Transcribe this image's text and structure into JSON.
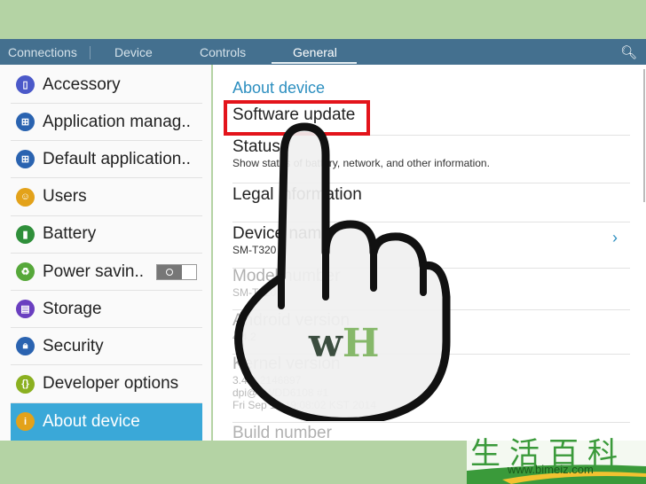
{
  "tabs": [
    {
      "label": "Connections"
    },
    {
      "label": "Device"
    },
    {
      "label": "Controls"
    },
    {
      "label": "General",
      "active": true
    }
  ],
  "search_icon": "search-icon",
  "sidebar": {
    "items": [
      {
        "label": "Accessory",
        "icon": "accessory-icon",
        "color": "#4b59c9"
      },
      {
        "label": "Application manag..",
        "icon": "apps-grid-icon",
        "color": "#2a63b0"
      },
      {
        "label": "Default application..",
        "icon": "default-apps-icon",
        "color": "#2a63b0"
      },
      {
        "label": "Users",
        "icon": "users-icon",
        "color": "#e3a21a"
      },
      {
        "label": "Battery",
        "icon": "battery-icon",
        "color": "#2f8f3a"
      },
      {
        "label": "Power savin..",
        "icon": "power-saving-icon",
        "color": "#56a83a",
        "toggle": "off"
      },
      {
        "label": "Storage",
        "icon": "storage-icon",
        "color": "#6a3fc0"
      },
      {
        "label": "Security",
        "icon": "lock-icon",
        "color": "#2a63b0"
      },
      {
        "label": "Developer options",
        "icon": "developer-icon",
        "color": "#8bb020"
      },
      {
        "label": "About device",
        "icon": "info-icon",
        "color": "#e3a21a",
        "selected": true
      }
    ]
  },
  "main": {
    "header": "About device",
    "rows": [
      {
        "title": "Software update",
        "sub": ""
      },
      {
        "title": "Status",
        "sub": "Show status of battery, network, and other information."
      },
      {
        "title": "Legal information",
        "sub": ""
      },
      {
        "title": "Device name",
        "sub": "SM-T320"
      },
      {
        "title": "Model number",
        "sub": "SM-T320"
      },
      {
        "title": "Android version",
        "sub": "4.4.2"
      },
      {
        "title": "Kernel version",
        "sub": "3.4.0-2146897\ndpi@SWDD6108 #1\nFri Sep 19 19:08:02 KST 2014"
      },
      {
        "title": "Build number",
        "sub": ""
      }
    ]
  },
  "overlay": {
    "logo": "wH"
  },
  "watermark": {
    "chinese": "生活百科",
    "url": "www.bimeiz.com"
  }
}
